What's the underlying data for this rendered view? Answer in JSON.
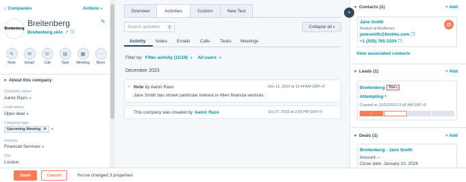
{
  "left": {
    "back_link": "Companies",
    "actions": "Actions",
    "company_name": "Breitenberg",
    "logo_text": "Breitenberg",
    "domain": "Breitenberg.skin",
    "action_buttons": [
      {
        "label": "Note",
        "icon": "note-icon",
        "glyph": "✎"
      },
      {
        "label": "Email",
        "icon": "email-icon",
        "glyph": "✉"
      },
      {
        "label": "Call",
        "icon": "call-icon",
        "glyph": "☏"
      },
      {
        "label": "Task",
        "icon": "task-icon",
        "glyph": "▤"
      },
      {
        "label": "Meeting",
        "icon": "meeting-icon",
        "glyph": "▦"
      },
      {
        "label": "More",
        "icon": "more-icon",
        "glyph": "···"
      }
    ],
    "about_title": "About this company",
    "fields": {
      "owner_label": "Company owner",
      "owner_value": "Aamir Razo",
      "lead_status_label": "Lead status",
      "lead_status_value": "Open deal",
      "tags_label": "Company tags",
      "tag_value": "Upcoming Meeting",
      "industry_label": "Industry",
      "industry_value": "Financial Services",
      "city_label": "City",
      "city_value": "London"
    }
  },
  "middle": {
    "tabs": [
      "Overview",
      "Activities",
      "Custom",
      "New Test"
    ],
    "search_placeholder": "Search activities",
    "collapse_all": "Collapse all",
    "subtabs": [
      "Activity",
      "Notes",
      "Emails",
      "Calls",
      "Tasks",
      "Meetings"
    ],
    "filter_by": "Filter by:",
    "filter_activity": "Filter activity (11/19)",
    "all_users": "All users",
    "month": "December 2023",
    "items": [
      {
        "type": "Note",
        "by": "by Aamir Razo",
        "timestamp": "Dec 11, 2023 at 11:44 AM GMT+5",
        "text": "Jane Smith has shown particular interest in Allen financia services."
      },
      {
        "text_prefix": "This company was created by",
        "creator": "Aamir Razo",
        "timestamp": "Oct 27, 2023 at 3:59 PM GMT+5"
      }
    ]
  },
  "right": {
    "contacts_title": "Contacts (1)",
    "add_label": "+ Add",
    "contact": {
      "name": "Jane Smith",
      "role": "Analyst at Redfames",
      "email": "janesmith@brekke.com",
      "phone": "+1 (555) 765-2234"
    },
    "view_contacts": "View associated contacts",
    "leads_title": "Leads (1)",
    "lead": {
      "name": "Breitenberg",
      "badge": "Hot",
      "stage": "Attempting",
      "created": "Created on 12/11/2023 11:41 AM GMT+5",
      "progress_steps": 5,
      "progress_done": 1,
      "progress_current": 2
    },
    "deals_title": "Deals (1)",
    "deal": {
      "name": "Breitenberg - Jane Smith",
      "amount": "Amount: --",
      "close_date": "Close date: January 10, 2024"
    }
  },
  "bottom": {
    "save": "Save",
    "cancel": "Cancel",
    "message": "You've changed 3 properties"
  },
  "colors": {
    "accent": "#ff7a59",
    "link": "#0091ae",
    "text": "#33475b"
  }
}
